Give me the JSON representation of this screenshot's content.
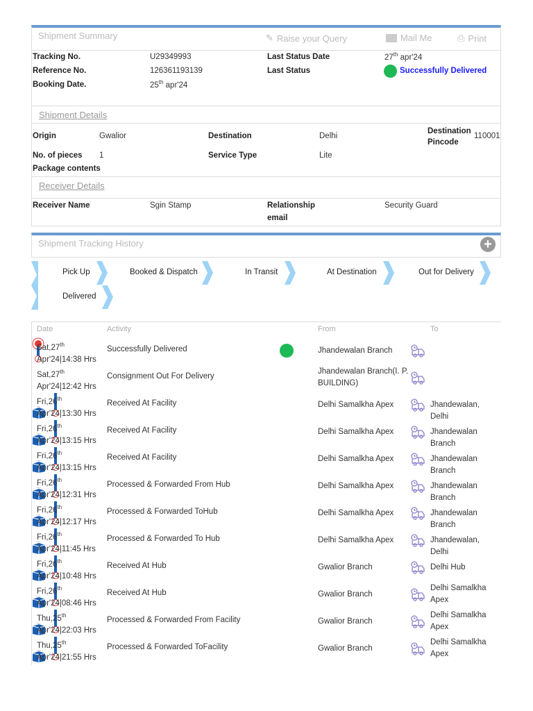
{
  "summary": {
    "title": "Shipment Summary",
    "raise_query": "Raise your Query",
    "mail_me": "Mail Me",
    "print": "Print",
    "tracking_label": "Tracking No.",
    "tracking_value": "U29349993",
    "reference_label": "Reference No.",
    "reference_value": "126361193139",
    "booking_label": "Booking Date.",
    "booking_day": "25",
    "booking_sup": "th",
    "booking_rest": " apr'24",
    "last_status_date_label": "Last Status Date",
    "last_status_day": "27",
    "last_status_sup": "th",
    "last_status_rest": " apr'24",
    "last_status_label": "Last Status",
    "last_status_value": "Successfully Delivered"
  },
  "details": {
    "title": "Shipment Details",
    "origin_label": "Origin",
    "origin": "Gwalior",
    "destination_label": "Destination",
    "destination": "Delhi",
    "pincode_label": "Destination Pincode",
    "pincode": "110001",
    "pieces_label": "No. of pieces",
    "pieces": "1",
    "service_label": "Service Type",
    "service": "Lite",
    "contents_label": "Package contents"
  },
  "receiver": {
    "title": "Receiver Details",
    "name_label": "Receiver Name",
    "name": "Sgin Stamp",
    "relationship_label": "Relationship",
    "relationship": "Security Guard",
    "email_label": "email"
  },
  "history": {
    "title": "Shipment Tracking History",
    "steps": [
      "Pick Up",
      "Booked & Dispatch",
      "In Transit",
      "At Destination",
      "Out for Delivery",
      "Delivered"
    ],
    "headers": {
      "date": "Date",
      "activity": "Activity",
      "from": "From",
      "to": "To"
    },
    "rows": [
      {
        "day": "Sat,27",
        "sup": "th",
        "time": "Apr'24|14:38 Hrs",
        "activity": "Successfully Delivered",
        "from": "Jhandewalan Branch",
        "to": "",
        "icon": "delivered"
      },
      {
        "day": "Sat,27",
        "sup": "th",
        "time": "Apr'24|12:42 Hrs",
        "activity": "Consignment Out For Delivery",
        "from": "Jhandewalan Branch(I. P. BUILDING)",
        "to": "",
        "icon": "none"
      },
      {
        "day": "Fri,26",
        "sup": "th",
        "time": "Apr'24|13:30 Hrs",
        "activity": "Received At Facility",
        "from": "Delhi Samalkha Apex",
        "to": "Jhandewalan, Delhi",
        "icon": "box"
      },
      {
        "day": "Fri,26",
        "sup": "th",
        "time": "Apr'24|13:15 Hrs",
        "activity": "Received At Facility",
        "from": "Delhi Samalkha Apex",
        "to": "Jhandewalan Branch",
        "icon": "box"
      },
      {
        "day": "Fri,26",
        "sup": "th",
        "time": "Apr'24|13:15 Hrs",
        "activity": "Received At Facility",
        "from": "Delhi Samalkha Apex",
        "to": "Jhandewalan Branch",
        "icon": "box"
      },
      {
        "day": "Fri,26",
        "sup": "th",
        "time": "Apr'24|12:31 Hrs",
        "activity": "Processed & Forwarded From Hub",
        "from": "Delhi Samalkha Apex",
        "to": "Jhandewalan Branch",
        "icon": "box"
      },
      {
        "day": "Fri,26",
        "sup": "th",
        "time": "Apr'24|12:17 Hrs",
        "activity": "Processed & Forwarded ToHub",
        "from": "Delhi Samalkha Apex",
        "to": "Jhandewalan Branch",
        "icon": "box"
      },
      {
        "day": "Fri,26",
        "sup": "th",
        "time": "Apr'24|11:45 Hrs",
        "activity": "Processed & Forwarded To Hub",
        "from": "Delhi Samalkha Apex",
        "to": "Jhandewalan, Delhi",
        "icon": "box"
      },
      {
        "day": "Fri,26",
        "sup": "th",
        "time": "Apr'24|10:48 Hrs",
        "activity": "Received At Hub",
        "from": "Gwalior Branch",
        "to": "Delhi Hub",
        "icon": "box"
      },
      {
        "day": "Fri,26",
        "sup": "th",
        "time": "Apr'24|08:46 Hrs",
        "activity": "Received At Hub",
        "from": "Gwalior Branch",
        "to": "Delhi Samalkha Apex",
        "icon": "box"
      },
      {
        "day": "Thu,25",
        "sup": "th",
        "time": "Apr'24|22:03 Hrs",
        "activity": "Processed & Forwarded From Facility",
        "from": "Gwalior Branch",
        "to": "Delhi Samalkha Apex",
        "icon": "box"
      },
      {
        "day": "Thu,25",
        "sup": "th",
        "time": "Apr'24|21:55 Hrs",
        "activity": "Processed & Forwarded ToFacility",
        "from": "Gwalior Branch",
        "to": "Delhi Samalkha Apex",
        "icon": "box"
      }
    ]
  },
  "colors": {
    "accent": "#6a9bd0",
    "status_green": "#1db954",
    "status_blue": "#1a1aff",
    "chevron": "#9ed3f5",
    "icon_blue": "#1a5fb4"
  }
}
